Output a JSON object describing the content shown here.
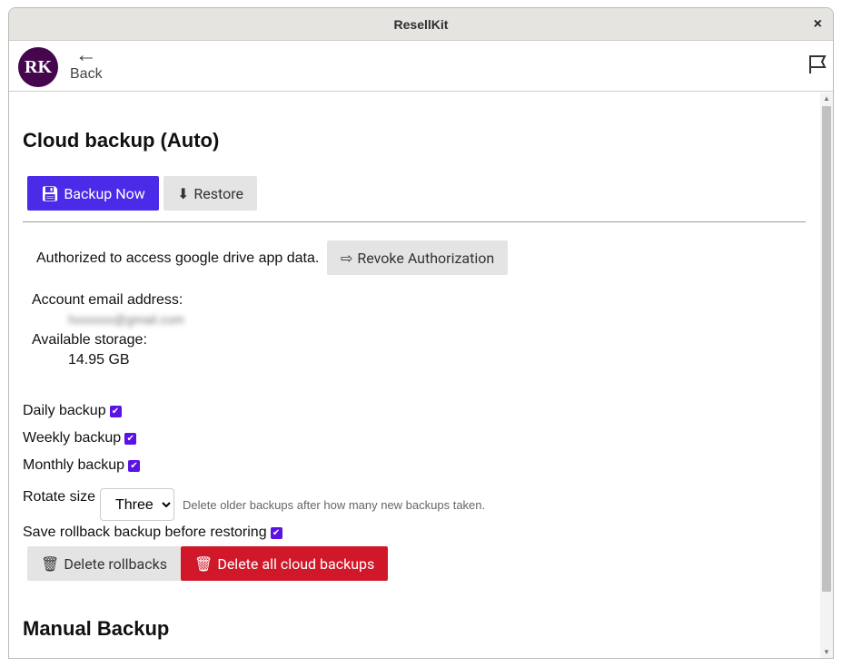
{
  "window": {
    "title": "ResellKit",
    "close": "×"
  },
  "appbar": {
    "avatar": "RK",
    "back_icon": "←",
    "back_label": "Back"
  },
  "cloud": {
    "title": "Cloud backup (Auto)",
    "backup_now": "Backup Now",
    "restore": "Restore",
    "auth_text": "Authorized to access google drive app data.",
    "revoke": "Revoke Authorization",
    "email_label": "Account email address:",
    "email_value": "hxxxxxx@gmail.com",
    "storage_label": "Available storage:",
    "storage_value": "14.95 GB",
    "options": [
      {
        "label": "Daily backup",
        "checked": true
      },
      {
        "label": "Weekly backup",
        "checked": true
      },
      {
        "label": "Monthly backup",
        "checked": true
      }
    ],
    "rotate_label": "Rotate size",
    "rotate_value": "Three",
    "rotate_hint": "Delete older backups after how many new backups taken.",
    "rollback_label": "Save rollback backup before restoring",
    "rollback_checked": true,
    "delete_rollbacks": "Delete rollbacks",
    "delete_all": "Delete all cloud backups"
  },
  "manual": {
    "title": "Manual Backup"
  },
  "colors": {
    "primary": "#4b2ae8",
    "danger": "#d0182a",
    "avatar": "#45064e"
  }
}
